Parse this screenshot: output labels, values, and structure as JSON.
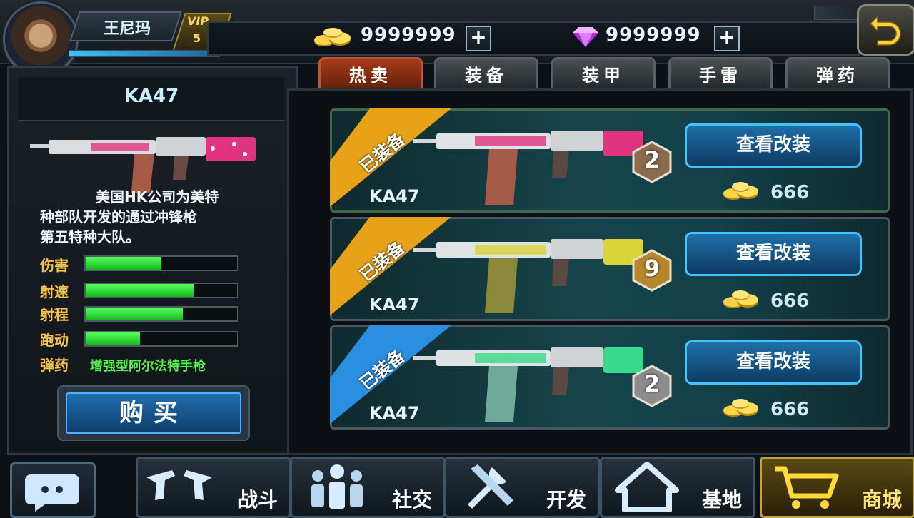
{
  "player": {
    "name": "王尼玛",
    "vip_label": "VIP",
    "vip_level": "5",
    "xp": 0.95
  },
  "currency": {
    "gold": "9999999",
    "diamond": "9999999",
    "add_label": "+"
  },
  "weapon": {
    "name": "KA47",
    "description_lines": [
      "美国HK公司为美特",
      "种部队开发的通过冲锋枪",
      "第五特种大队。"
    ],
    "stats": [
      {
        "label": "伤害",
        "value": 0.5
      },
      {
        "label": "射速",
        "value": 0.71
      },
      {
        "label": "射程",
        "value": 0.64
      },
      {
        "label": "跑动",
        "value": 0.36
      }
    ],
    "ammo_label": "弹药",
    "ammo_value": "增强型阿尔法特手枪",
    "buy_label": "购买"
  },
  "tabs": [
    "热卖",
    "装备",
    "装甲",
    "手雷",
    "弹药"
  ],
  "active_tab": 0,
  "items": [
    {
      "name": "KA47",
      "tag": "已装备",
      "level": "2",
      "button": "查看改装",
      "price": "666",
      "ribbon_color": "#e8a21a",
      "badge_color": "#8a6b4e",
      "pattern": "#e0357e"
    },
    {
      "name": "KA47",
      "tag": "已装备",
      "level": "9",
      "button": "查看改装",
      "price": "666",
      "ribbon_color": "#e8a21a",
      "badge_color": "#b8862a",
      "pattern": "#d8d43a"
    },
    {
      "name": "KA47",
      "tag": "已装备",
      "level": "2",
      "button": "查看改装",
      "price": "666",
      "ribbon_color": "#2a8fe0",
      "badge_color": "#8c8c8c",
      "pattern": "#3ad88a"
    }
  ],
  "nav": [
    "战斗",
    "社交",
    "开发",
    "基地",
    "商城"
  ],
  "active_nav": 4
}
